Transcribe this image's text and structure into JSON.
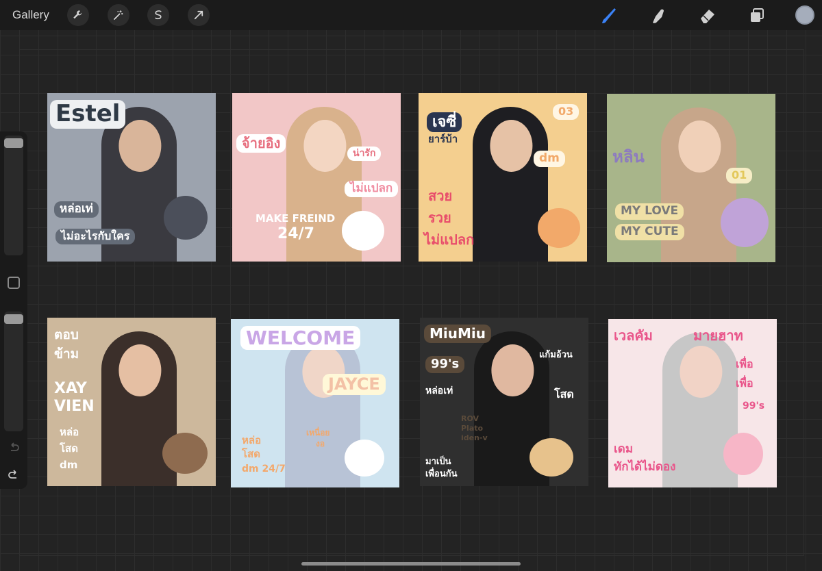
{
  "toolbar": {
    "gallery_label": "Gallery",
    "left_tools": [
      "wrench-icon",
      "magic-wand-icon",
      "selection-icon",
      "transform-arrow-icon"
    ],
    "right_tools": [
      "brush-icon",
      "smudge-icon",
      "eraser-icon",
      "layers-icon"
    ],
    "active_tool": "brush-icon",
    "accent": "#3b82f6",
    "current_color": "#a5adbb"
  },
  "sidebar": {
    "controls": [
      "brush-size-slider",
      "modify-button",
      "opacity-slider",
      "undo-icon",
      "redo-icon"
    ]
  },
  "tiles": [
    {
      "stickers": [
        "Estel",
        "หล่อเท่",
        "ไม่อะไรกับใคร"
      ]
    },
    {
      "stickers": [
        "จ้ายอิง",
        "น่ารัก",
        "ไม่แปลก",
        "MAKE FREIND",
        "24/7"
      ]
    },
    {
      "stickers": [
        "เจซี่",
        "ยาร์บ้า",
        "03",
        "dm",
        "สวย",
        "รวย",
        "ไม่แปลก"
      ]
    },
    {
      "stickers": [
        "หลิน",
        "01",
        "MY LOVE",
        "MY CUTE"
      ]
    },
    {
      "stickers": [
        "ตอบ",
        "ข้าม",
        "XAY",
        "VIEN",
        "หล่อ",
        "โสด",
        "dm"
      ]
    },
    {
      "stickers": [
        "WELCOME",
        "JAYCE",
        "หล่อ",
        "โสด",
        "dm 24/7",
        "เหนื่อย",
        "งอ"
      ]
    },
    {
      "stickers": [
        "MiuMiu",
        "99's",
        "แก้มอ้วน",
        "หล่อเท่",
        "โสด",
        "ROV",
        "Plato",
        "iden-v",
        "มาเป็น",
        "เพื่อนกัน"
      ]
    },
    {
      "stickers": [
        "เวลคัม",
        "มายฮาท",
        "เพื่อ",
        "เพื่อ",
        "99's",
        "เดม",
        "ทักได้ไม่ดอง"
      ]
    }
  ]
}
